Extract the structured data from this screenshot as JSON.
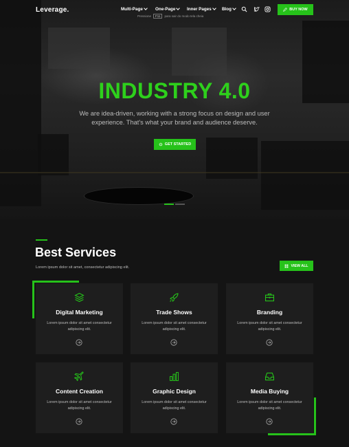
{
  "nav": {
    "logo": "Leverage.",
    "menu": [
      "Multi-Page",
      "One-Page",
      "Inner Pages",
      "Blog"
    ],
    "buy_label": "BUY NOW",
    "subline_before": "Pressione",
    "subline_key": "F11",
    "subline_after": "para sair do modo tela cheia"
  },
  "hero": {
    "title": "INDUSTRY 4.0",
    "text": "We are idea-driven, working with a strong focus on design and user experience. That's what your brand and audience deserve.",
    "cta_label": "GET STARTED",
    "slides": 2,
    "active_slide": 1
  },
  "services": {
    "title": "Best Services",
    "subtitle": "Lorem ipsum dolor sit amet, consectetur adipiscing elit.",
    "view_all_label": "VIEW ALL",
    "cards": [
      {
        "title": "Digital Marketing",
        "desc": "Lorem ipsum dolor sit amet consectetur adipiscing elit.",
        "icon": "layers-icon"
      },
      {
        "title": "Trade Shows",
        "desc": "Lorem ipsum dolor sit amet consectetur adipiscing elit.",
        "icon": "rocket-icon"
      },
      {
        "title": "Branding",
        "desc": "Lorem ipsum dolor sit amet consectetur adipiscing elit.",
        "icon": "briefcase-icon"
      },
      {
        "title": "Content Creation",
        "desc": "Lorem ipsum dolor sit amet consectetur adipiscing elit.",
        "icon": "airplane-icon"
      },
      {
        "title": "Graphic Design",
        "desc": "Lorem ipsum dolor sit amet consectetur adipiscing elit.",
        "icon": "bar-chart-icon"
      },
      {
        "title": "Media Buying",
        "desc": "Lorem ipsum dolor sit amet consectetur adipiscing elit.",
        "icon": "inbox-icon"
      }
    ]
  },
  "colors": {
    "accent": "#26c21a",
    "background": "#141414",
    "card": "#1e1e1e"
  }
}
